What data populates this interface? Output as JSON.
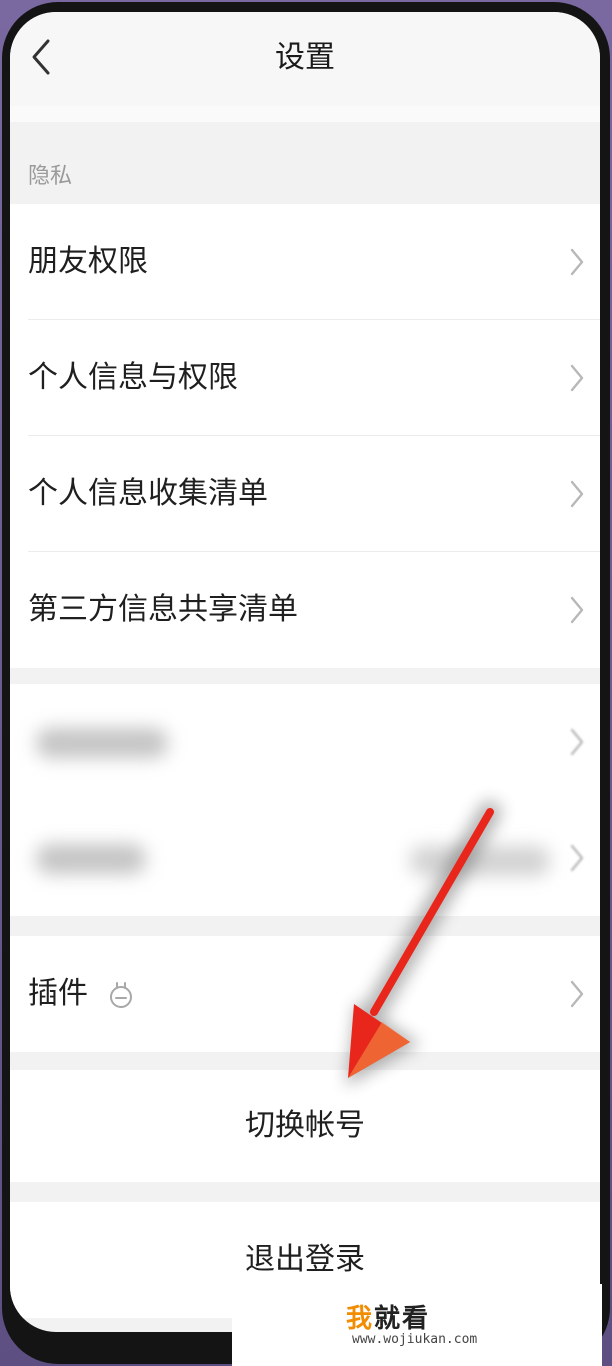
{
  "header": {
    "title": "设置",
    "back_icon": "chevron-left-icon"
  },
  "privacy": {
    "section_label": "隐私",
    "items": [
      {
        "label": "朋友权限"
      },
      {
        "label": "个人信息与权限"
      },
      {
        "label": "个人信息收集清单"
      },
      {
        "label": "第三方信息共享清单"
      }
    ]
  },
  "blurred_group": {
    "items": [
      {
        "label": ""
      },
      {
        "label": ""
      }
    ]
  },
  "plugins": {
    "label": "插件",
    "icon": "plugin-icon"
  },
  "actions": {
    "switch_account": "切换帐号",
    "logout": "退出登录"
  },
  "annotation": {
    "arrow_color": "#e8261c"
  },
  "watermark": {
    "accent_char": "我",
    "rest": "就看",
    "url": "www.wojiukan.com"
  }
}
